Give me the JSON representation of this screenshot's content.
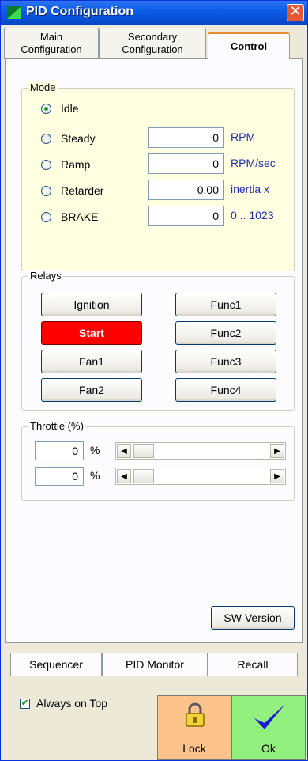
{
  "window": {
    "title": "PID Configuration",
    "close_label": "✕"
  },
  "tabs": [
    {
      "line1": "Main",
      "line2": "Configuration",
      "active": false
    },
    {
      "line1": "Secondary",
      "line2": "Configuration",
      "active": false
    },
    {
      "line1": "Control",
      "line2": "",
      "active": true
    }
  ],
  "mode": {
    "label": "Mode",
    "options": [
      {
        "label": "Idle",
        "checked": true
      },
      {
        "label": "Steady",
        "checked": false,
        "value": "0",
        "unit": "RPM"
      },
      {
        "label": "Ramp",
        "checked": false,
        "value": "0",
        "unit": "RPM/sec"
      },
      {
        "label": "Retarder",
        "checked": false,
        "value": "0.00",
        "unit": "inertia x"
      },
      {
        "label": "BRAKE",
        "checked": false,
        "value": "0",
        "unit": "0 .. 1023"
      }
    ]
  },
  "relays": {
    "label": "Relays",
    "left": [
      "Ignition",
      "Start",
      "Fan1",
      "Fan2"
    ],
    "right": [
      "Func1",
      "Func2",
      "Func3",
      "Func4"
    ],
    "active": "Start"
  },
  "throttle": {
    "label": "Throttle (%)",
    "rows": [
      {
        "value": "0",
        "unit": "%",
        "level": 0
      },
      {
        "value": "0",
        "unit": "%",
        "level": 0
      }
    ]
  },
  "sw_version_label": "SW Version",
  "bottom_tabs": [
    "Sequencer",
    "PID Monitor",
    "Recall"
  ],
  "always_on_top": {
    "label": "Always on Top",
    "checked": true
  },
  "lock_label": "Lock",
  "ok_label": "Ok",
  "colors": {
    "title_bar": "#0a5ee8",
    "mode_panel": "#ffffe1",
    "start_button": "#ff0000",
    "lock_button": "#fbc28c",
    "ok_button": "#93f07f",
    "unit_text": "#1f2fa8"
  }
}
